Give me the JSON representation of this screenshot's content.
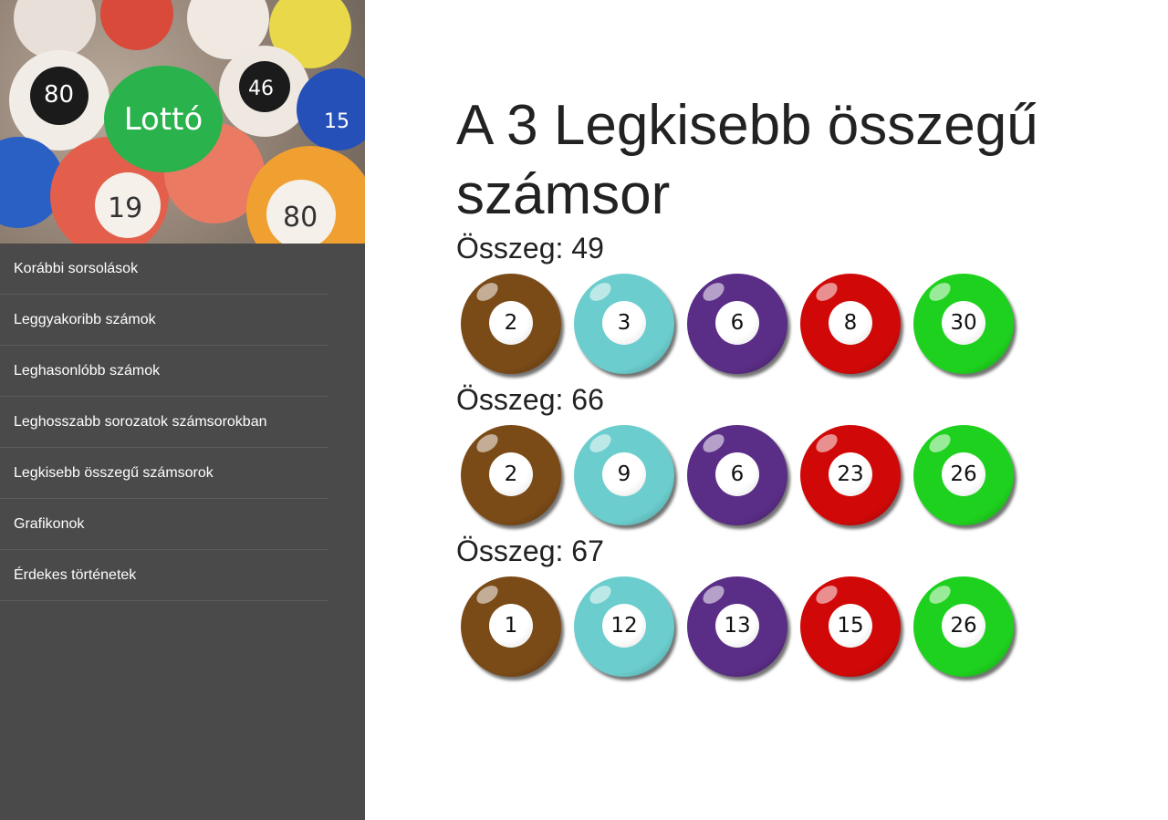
{
  "logo": {
    "text": "Lottó"
  },
  "nav": {
    "items": [
      "Korábbi sorsolások",
      "Leggyakoribb számok",
      "Leghasonlóbb számok",
      "Leghosszabb sorozatok számsorokban",
      "Legkisebb összegű számsorok",
      "Grafikonok",
      "Érdekes történetek"
    ]
  },
  "page": {
    "title": "A 3 Legkisebb összegű számsor"
  },
  "ball_colors": [
    "#7a4a17",
    "#6bcdcd",
    "#5a2d86",
    "#d10808",
    "#1ed11e"
  ],
  "groups": [
    {
      "sum_label": "Összeg: 49",
      "numbers": [
        "2",
        "3",
        "6",
        "8",
        "30"
      ]
    },
    {
      "sum_label": "Összeg: 66",
      "numbers": [
        "2",
        "9",
        "6",
        "23",
        "26"
      ]
    },
    {
      "sum_label": "Összeg: 67",
      "numbers": [
        "1",
        "12",
        "13",
        "15",
        "26"
      ]
    }
  ]
}
